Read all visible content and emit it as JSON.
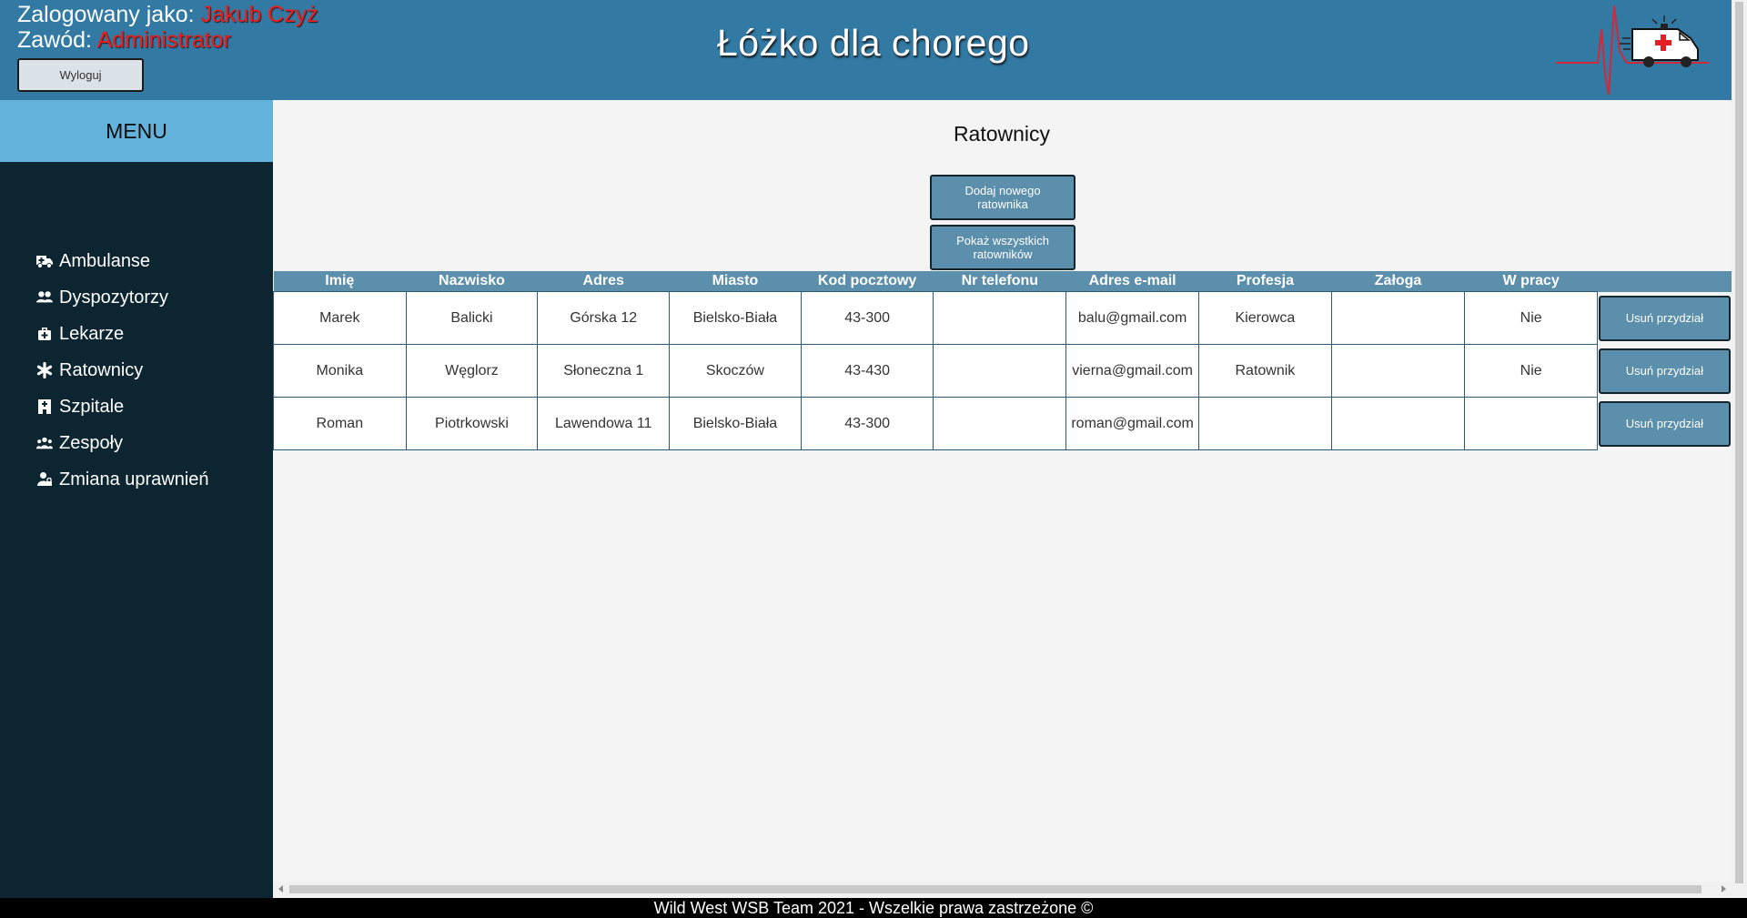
{
  "header": {
    "logged_as_label": "Zalogowany jako:",
    "logged_as_name": "Jakub Czyż",
    "profession_label": "Zawód:",
    "profession_value": "Administrator",
    "logout_label": "Wyloguj",
    "app_title": "Łóżko dla chorego",
    "logo_icon": "ambulance-heartbeat-logo"
  },
  "sidebar": {
    "menu_title": "MENU",
    "items": [
      {
        "label": "Ambulanse",
        "icon": "ambulance-icon"
      },
      {
        "label": "Dyspozytorzy",
        "icon": "users-icon"
      },
      {
        "label": "Lekarze",
        "icon": "medkit-icon"
      },
      {
        "label": "Ratownicy",
        "icon": "asterisk-icon"
      },
      {
        "label": "Szpitale",
        "icon": "hospital-icon"
      },
      {
        "label": "Zespoły",
        "icon": "team-icon"
      },
      {
        "label": "Zmiana uprawnień",
        "icon": "user-lock-icon"
      }
    ]
  },
  "main": {
    "page_title": "Ratownicy",
    "add_button": "Dodaj nowego ratownika",
    "show_all_button": "Pokaż wszystkich ratowników",
    "table": {
      "columns": [
        "Imię",
        "Nazwisko",
        "Adres",
        "Miasto",
        "Kod pocztowy",
        "Nr telefonu",
        "Adres e-mail",
        "Profesja",
        "Załoga",
        "W pracy"
      ],
      "rows": [
        [
          "Marek",
          "Balicki",
          "Górska 12",
          "Bielsko-Biała",
          "43-300",
          "",
          "balu@gmail.com",
          "Kierowca",
          "",
          "Nie"
        ],
        [
          "Monika",
          "Węglorz",
          "Słoneczna 1",
          "Skoczów",
          "43-430",
          "",
          "vierna@gmail.com",
          "Ratownik",
          "",
          "Nie"
        ],
        [
          "Roman",
          "Piotrkowski",
          "Lawendowa 11",
          "Bielsko-Biała",
          "43-300",
          "",
          "roman@gmail.com",
          "",
          "",
          ""
        ]
      ],
      "row_action_label": "Usuń przydział"
    }
  },
  "footer": {
    "text": "Wild West WSB Team 2021 - Wszelkie prawa zastrzeżone ©"
  },
  "colors": {
    "header_bg": "#327aa4",
    "menu_header_bg": "#63b2db",
    "sidebar_bg": "#0c2531",
    "button_bg": "#5b8fab",
    "highlight_red": "#ef1c1c"
  }
}
